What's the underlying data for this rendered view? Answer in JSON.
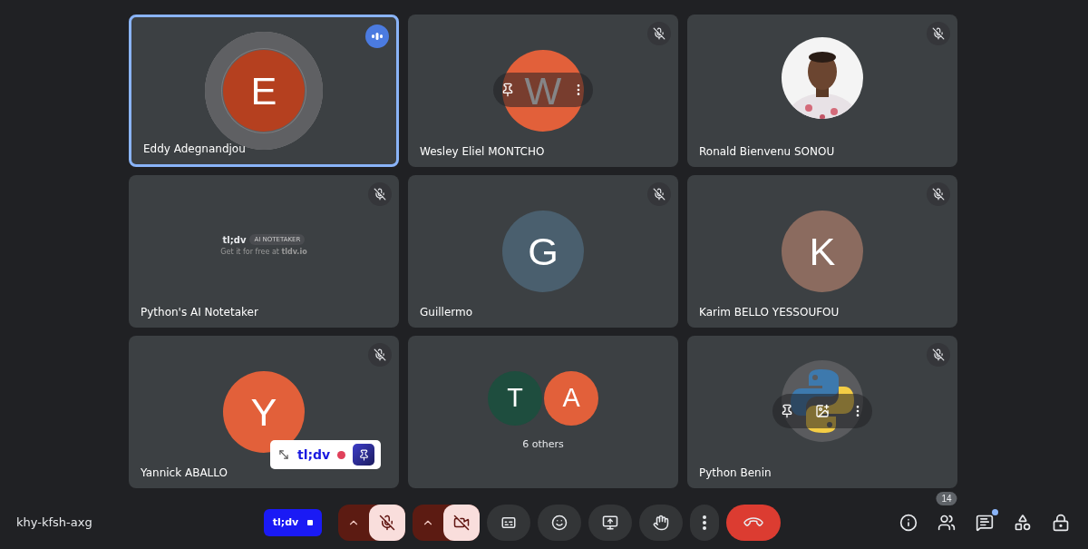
{
  "tiles": [
    {
      "kind": "avatar",
      "name": "Eddy Adegnandjou",
      "initial": "E",
      "color": "#b5401f",
      "speaking": true,
      "muted": false,
      "hovered": false
    },
    {
      "kind": "avatar",
      "name": "Wesley Eliel MONTCHO",
      "initial": "W",
      "color": "#e2603a",
      "speaking": false,
      "muted": true,
      "hovered": true
    },
    {
      "name": "Ronald Bienvenu SONOU",
      "speaking": false,
      "muted": true,
      "hovered": false
    },
    {
      "kind": "bot",
      "name": "Python's AI Notetaker",
      "brand": "tl;dv",
      "badge": "AI NOTETAKER",
      "promo": "Get it for free at **tldv.io**",
      "speaking": false,
      "muted": true,
      "hovered": false
    },
    {
      "kind": "avatar",
      "name": "Guillermo",
      "initial": "G",
      "color": "#4a5f6e",
      "speaking": false,
      "muted": true,
      "hovered": false
    },
    {
      "kind": "avatar",
      "name": "Karim BELLO YESSOUFOU",
      "initial": "K",
      "color": "#8b6b5f",
      "speaking": false,
      "muted": true,
      "hovered": false
    },
    {
      "kind": "avatar",
      "name": "Yannick ABALLO",
      "initial": "Y",
      "color": "#e2603a",
      "speaking": false,
      "muted": true,
      "hovered": false,
      "recorder": {
        "brand": "tl;dv",
        "recording": true
      }
    },
    {
      "kind": "group",
      "caption": "6 others",
      "avatars": [
        {
          "initial": "T",
          "color": "#1e4d3e"
        },
        {
          "initial": "A",
          "color": "#e2603a"
        }
      ],
      "speaking": false,
      "muted": false,
      "hovered": false
    },
    {
      "kind": "logo",
      "name": "Python Benin",
      "speaking": false,
      "muted": true,
      "hovered": true
    }
  ],
  "meeting_code": "khy-kfsh-axg",
  "controls": [
    {
      "kind": "recorder",
      "label": "tl;dv",
      "on": true
    },
    {
      "kind": "mic",
      "on": false
    },
    {
      "kind": "camera",
      "on": false
    },
    {
      "kind": "captions"
    },
    {
      "kind": "emoji"
    },
    {
      "kind": "present"
    },
    {
      "kind": "hand"
    },
    {
      "kind": "more"
    },
    {
      "kind": "leave"
    }
  ],
  "side": [
    {
      "kind": "info"
    },
    {
      "kind": "people",
      "count": "14"
    },
    {
      "kind": "chat",
      "unread": true
    },
    {
      "kind": "activities"
    },
    {
      "kind": "host"
    }
  ]
}
